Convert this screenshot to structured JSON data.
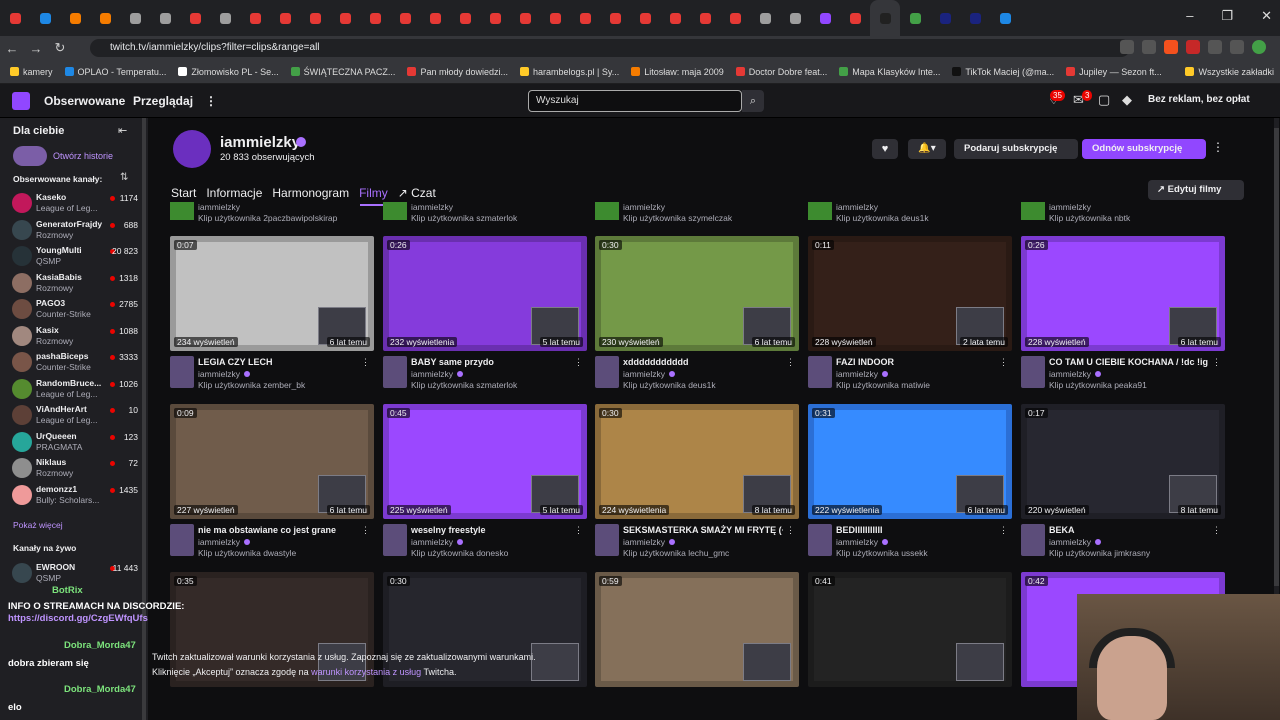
{
  "browser": {
    "url": "twitch.tv/iammielzky/clips?filter=clips&range=all",
    "tab_colors": [
      "#e53935",
      "#1e88e5",
      "#f57c00",
      "#f57c00",
      "#9e9e9e",
      "#9e9e9e",
      "#e53935",
      "#9e9e9e",
      "#e53935",
      "#e53935",
      "#e53935",
      "#e53935",
      "#e53935",
      "#e53935",
      "#e53935",
      "#e53935",
      "#e53935",
      "#e53935",
      "#e53935",
      "#e53935",
      "#e53935",
      "#e53935",
      "#e53935",
      "#e53935",
      "#e53935",
      "#9e9e9e",
      "#9e9e9e",
      "#9147ff",
      "#e53935",
      "#212121",
      "#43a047",
      "#1a237e",
      "#1a237e",
      "#1e88e5"
    ],
    "bookmarks": [
      {
        "label": "kamery",
        "color": "#ffca28"
      },
      {
        "label": "OPLAO - Temperatu...",
        "color": "#1e88e5"
      },
      {
        "label": "Złomowisko PL - Se...",
        "color": "#fff"
      },
      {
        "label": "ŚWIĄTECZNA PACZ...",
        "color": "#43a047"
      },
      {
        "label": "Pan młody dowiedzi...",
        "color": "#e53935"
      },
      {
        "label": "harambelogs.pl | Sy...",
        "color": "#ffca28"
      },
      {
        "label": "Litosław: maja 2009",
        "color": "#f57c00"
      },
      {
        "label": "Doctor Dobre feat...",
        "color": "#e53935"
      },
      {
        "label": "Mapa Klasyków Inte...",
        "color": "#43a047"
      },
      {
        "label": "TikTok Maciej (@ma...",
        "color": "#111"
      },
      {
        "label": "Jupiley — Sezon ft...",
        "color": "#e53935"
      },
      {
        "label": "Wszystkie zakładki",
        "color": "#ffca28"
      }
    ]
  },
  "topnav": {
    "following": "Obserwowane",
    "browse": "Przeglądaj",
    "search_placeholder": "Wyszukaj",
    "notif_count": "35",
    "inbox_count": "3",
    "ad_free": "Bez reklam, bez opłat"
  },
  "sidebar": {
    "title": "Dla ciebie",
    "stories": "Otwórz historie",
    "followed_title": "Obserwowane kanały:",
    "channels": [
      {
        "name": "Kaseko",
        "category": "League of Leg...",
        "viewers": "1174",
        "color": "#c2185b"
      },
      {
        "name": "GeneratorFrajdy",
        "category": "Rozmowy",
        "viewers": "688",
        "color": "#37474f"
      },
      {
        "name": "YoungMulti",
        "category": "QSMP",
        "viewers": "20 823",
        "color": "#263238"
      },
      {
        "name": "KasiaBabis",
        "category": "Rozmowy",
        "viewers": "1318",
        "color": "#8d6e63"
      },
      {
        "name": "PAGO3",
        "category": "Counter-Strike",
        "viewers": "2785",
        "color": "#6d4c41"
      },
      {
        "name": "Kasix",
        "category": "Rozmowy",
        "viewers": "1088",
        "color": "#a1887f"
      },
      {
        "name": "pashaBiceps",
        "category": "Counter-Strike",
        "viewers": "3333",
        "color": "#795548"
      },
      {
        "name": "RandomBruce...",
        "category": "League of Leg...",
        "viewers": "1026",
        "color": "#558b2f"
      },
      {
        "name": "ViAndHerArt",
        "category": "League of Leg...",
        "viewers": "10",
        "color": "#5d4037"
      },
      {
        "name": "UrQueeen",
        "category": "PRAGMATA",
        "viewers": "123",
        "color": "#26a69a"
      },
      {
        "name": "Niklaus",
        "category": "Rozmowy",
        "viewers": "72",
        "color": "#8e8e8e"
      },
      {
        "name": "demonzz1",
        "category": "Bully: Scholars...",
        "viewers": "1435",
        "color": "#ef9a9a"
      }
    ],
    "show_more": "Pokaż więcej",
    "live_title": "Kanały na żywo",
    "live": [
      {
        "name": "EWROON",
        "category": "QSMP",
        "viewers": "11 443",
        "color": "#37474f"
      }
    ]
  },
  "channel": {
    "name": "iammielzky",
    "followers": "20 833 obserwujących",
    "gift_sub": "Podaruj subskrypcję",
    "renew_sub": "Odnów subskrypcję",
    "tabs": [
      "Start",
      "Informacje",
      "Harmonogram",
      "Filmy",
      "Czat"
    ],
    "edit_clips": "Edytuj filmy"
  },
  "top_partial": [
    {
      "channel": "iammielzky",
      "by": "Klip użytkownika 2paczbawipolskirap"
    },
    {
      "channel": "iammielzky",
      "by": "Klip użytkownika szmaterlok"
    },
    {
      "channel": "iammielzky",
      "by": "Klip użytkownika szymelczak"
    },
    {
      "channel": "iammielzky",
      "by": "Klip użytkownika deus1k"
    },
    {
      "channel": "iammielzky",
      "by": "Klip użytkownika nbtk"
    }
  ],
  "clips_row1": [
    {
      "duration": "0:07",
      "views": "234 wyświetleń",
      "ago": "6 lat temu",
      "title": "LEGIA CZY LECH",
      "channel": "iammielzky",
      "by": "Klip użytkownika zember_bk",
      "bg": "#9a9a9a"
    },
    {
      "duration": "0:26",
      "views": "232 wyświetlenia",
      "ago": "5 lat temu",
      "title": "BABY same przydo",
      "channel": "iammielzky",
      "by": "Klip użytkownika szmaterlok",
      "bg": "#6a2fb0"
    },
    {
      "duration": "0:30",
      "views": "230 wyświetleń",
      "ago": "6 lat temu",
      "title": "xddddddddddd",
      "channel": "iammielzky",
      "by": "Klip użytkownika deus1k",
      "bg": "#5d7a3a"
    },
    {
      "duration": "0:11",
      "views": "228 wyświetleń",
      "ago": "2 lata temu",
      "title": "FAZI INDOOR",
      "channel": "iammielzky",
      "by": "Klip użytkownika matiwie",
      "bg": "#2a1a14"
    },
    {
      "duration": "0:26",
      "views": "228 wyświetleń",
      "ago": "6 lat temu",
      "title": "CO TAM U CIEBIE KOCHANA / !dc !ig !k...",
      "channel": "iammielzky",
      "by": "Klip użytkownika peaka91",
      "bg": "#7c3ad1"
    }
  ],
  "clips_row2": [
    {
      "duration": "0:09",
      "views": "227 wyświetleń",
      "ago": "6 lat temu",
      "title": "nie ma obstawiane co jest grane",
      "channel": "iammielzky",
      "by": "Klip użytkownika dwastyle",
      "bg": "#5a4a3c"
    },
    {
      "duration": "0:45",
      "views": "225 wyświetleń",
      "ago": "5 lat temu",
      "title": "weselny freestyle",
      "channel": "iammielzky",
      "by": "Klip użytkownika donesko",
      "bg": "#7c3ad1"
    },
    {
      "duration": "0:30",
      "views": "224 wyświetlenia",
      "ago": "8 lat temu",
      "title": "SEKSMASTERKA SMAŻY MI FRYTĘ (+...",
      "channel": "iammielzky",
      "by": "Klip użytkownika lechu_gmc",
      "bg": "#8a6a3a"
    },
    {
      "duration": "0:31",
      "views": "222 wyświetlenia",
      "ago": "6 lat temu",
      "title": "BEDIIIIIIIIIII",
      "channel": "iammielzky",
      "by": "Klip użytkownika ussekk",
      "bg": "#2b6fd6"
    },
    {
      "duration": "0:17",
      "views": "220 wyświetleń",
      "ago": "8 lat temu",
      "title": "BEKA",
      "channel": "iammielzky",
      "by": "Klip użytkownika jimkrasny",
      "bg": "#1f1f26"
    }
  ],
  "clips_row3": [
    {
      "duration": "0:35",
      "bg": "#2a2220"
    },
    {
      "duration": "0:30",
      "bg": "#1e1e24"
    },
    {
      "duration": "0:59",
      "bg": "#6a5a48"
    },
    {
      "duration": "0:41",
      "bg": "#1c1c1c"
    },
    {
      "duration": "0:42",
      "bg": "#7c3ad1"
    }
  ],
  "notice": {
    "line1": "Twitch zaktualizował warunki korzystania z usług. Zapoznaj się ze zaktualizowanymi warunkami.",
    "line2_pre": "Kliknięcie „Akceptuj” oznacza zgodę na ",
    "line2_link": "warunki korzystania z usług",
    "line2_post": " Twitcha."
  },
  "chat_overlay": {
    "bot": "BotRix",
    "info": "INFO O STREAMACH NA DISCORDZIE:",
    "link": "https://discord.gg/CzgEWfqUfs",
    "user1": "Dobra_Morda47",
    "msg1": "dobra zbieram się",
    "user2": "Dobra_Morda47",
    "msg2": "elo"
  }
}
